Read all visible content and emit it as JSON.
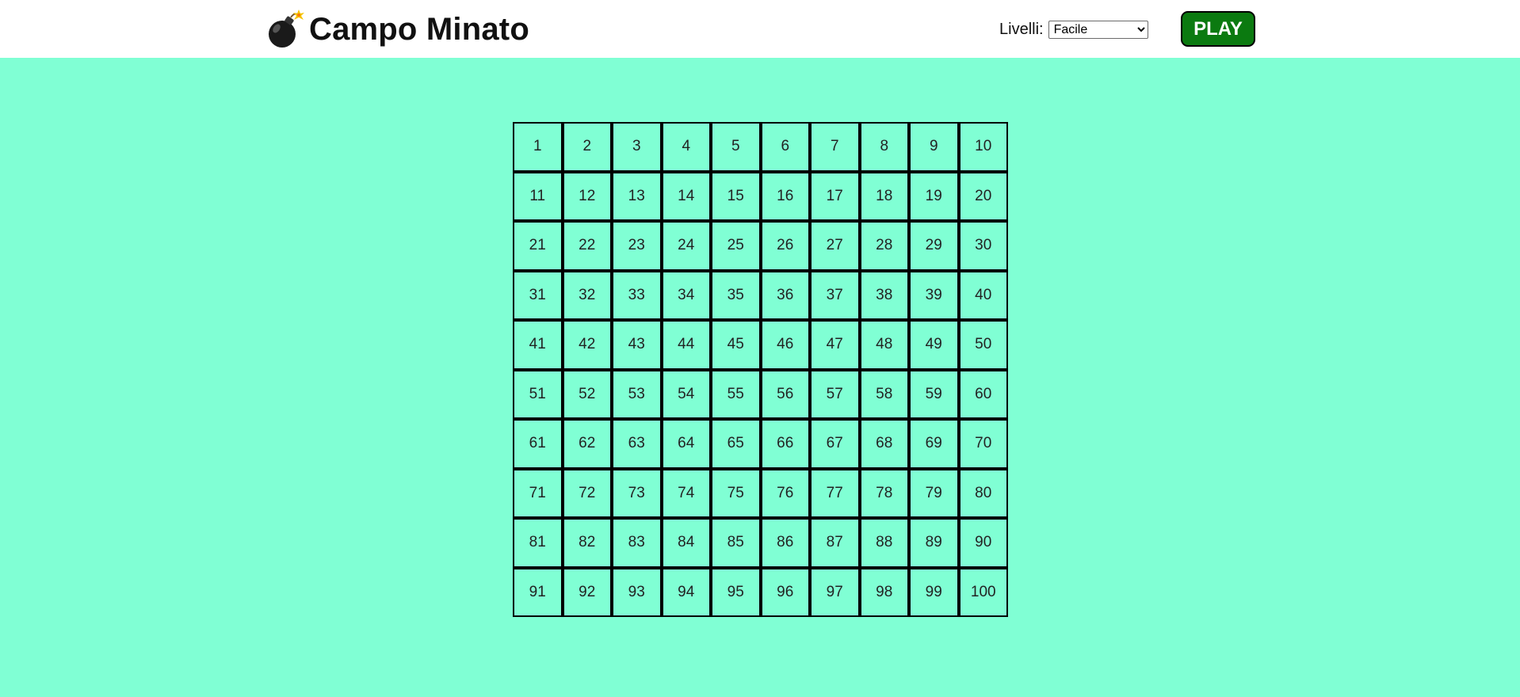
{
  "header": {
    "title": "Campo Minato",
    "logo_icon": "bomb-icon",
    "level_label": "Livelli:",
    "level_selected": "Facile",
    "play_label": "PLAY"
  },
  "board": {
    "rows": 10,
    "cols": 10,
    "cells": [
      "1",
      "2",
      "3",
      "4",
      "5",
      "6",
      "7",
      "8",
      "9",
      "10",
      "11",
      "12",
      "13",
      "14",
      "15",
      "16",
      "17",
      "18",
      "19",
      "20",
      "21",
      "22",
      "23",
      "24",
      "25",
      "26",
      "27",
      "28",
      "29",
      "30",
      "31",
      "32",
      "33",
      "34",
      "35",
      "36",
      "37",
      "38",
      "39",
      "40",
      "41",
      "42",
      "43",
      "44",
      "45",
      "46",
      "47",
      "48",
      "49",
      "50",
      "51",
      "52",
      "53",
      "54",
      "55",
      "56",
      "57",
      "58",
      "59",
      "60",
      "61",
      "62",
      "63",
      "64",
      "65",
      "66",
      "67",
      "68",
      "69",
      "70",
      "71",
      "72",
      "73",
      "74",
      "75",
      "76",
      "77",
      "78",
      "79",
      "80",
      "81",
      "82",
      "83",
      "84",
      "85",
      "86",
      "87",
      "88",
      "89",
      "90",
      "91",
      "92",
      "93",
      "94",
      "95",
      "96",
      "97",
      "98",
      "99",
      "100"
    ]
  },
  "colors": {
    "background": "#80ffd4",
    "play_button": "#0b7a10",
    "cell_border": "#000000"
  }
}
